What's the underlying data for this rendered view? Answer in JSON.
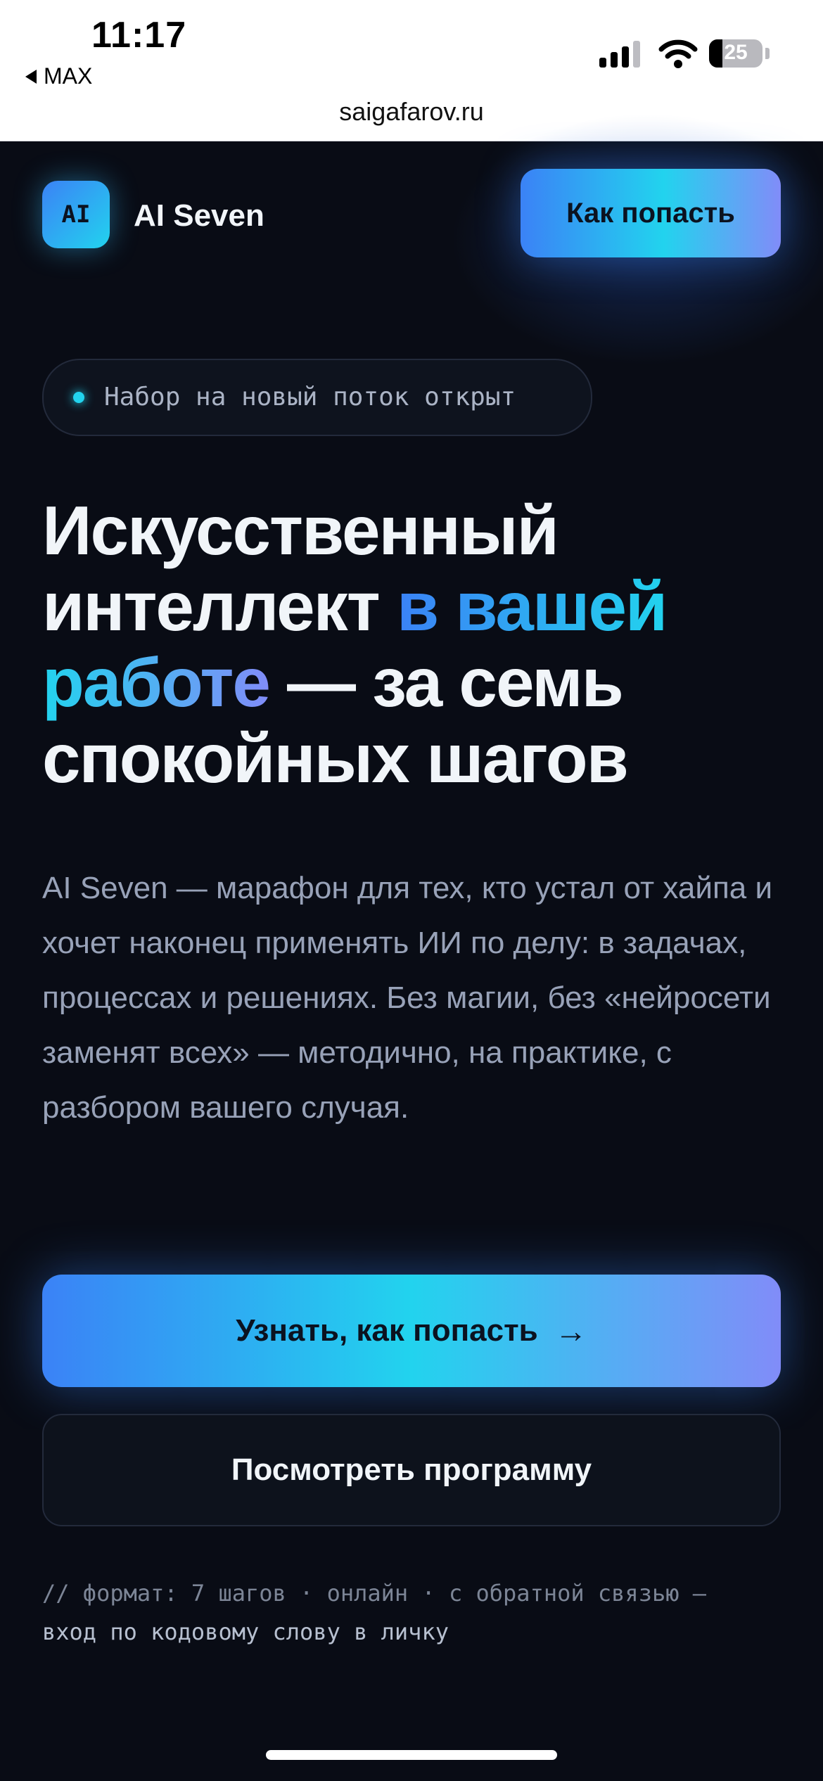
{
  "status_bar": {
    "time": "11:17",
    "back_label": "MAX",
    "battery_level": "25",
    "battery_fraction": 0.25,
    "signal_bars_active": 3,
    "signal_bars_total": 4
  },
  "browser": {
    "url": "saigafarov.ru"
  },
  "header": {
    "logo_text": "AI",
    "brand": "AI Seven",
    "nav_button": "Как попасть"
  },
  "hero": {
    "badge": "Набор на новый поток открыт",
    "headline": {
      "part1": "Искусственный интеллект ",
      "accent1": "в вашей",
      "space": " ",
      "accent2": "работе",
      "part2": " — за семь спокойных шагов"
    },
    "lead": "AI Seven — марафон для тех, кто устал от хайпа и хочет наконец применять ИИ по делу: в задачах, процессах и решениях. Без магии, без «нейросети заменят всех» — методично, на практике, с разбором вашего случая.",
    "primary_button": "Узнать, как попасть",
    "primary_arrow": "→",
    "secondary_button": "Посмотреть программу",
    "note_line1": "// формат: 7 шагов · онлайн · с обратной связью —",
    "note_line2": "вход по кодовому слову в личку"
  },
  "colors": {
    "background": "#090c15",
    "accent_blue": "#3b82f6",
    "accent_cyan": "#22d3ee",
    "accent_violet": "#818cf8",
    "text_primary": "#f1f5f9",
    "text_muted": "#98a2b8"
  },
  "icons": [
    "back-arrow-icon",
    "signal-icon",
    "wifi-icon",
    "battery-icon",
    "status-dot-icon",
    "arrow-right-icon"
  ]
}
